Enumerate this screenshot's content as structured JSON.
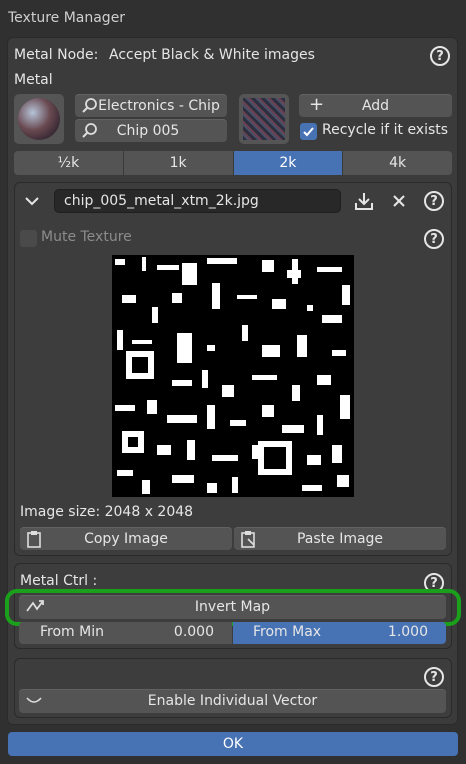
{
  "window": {
    "title": "Texture Manager"
  },
  "header": {
    "node_label": "Metal Node:",
    "node_value": "Accept Black & White images",
    "section": "Metal"
  },
  "material": {
    "search1": "Electronics - Chip",
    "search2": "Chip 005",
    "add_label": "Add",
    "recycle_label": "Recycle if it exists",
    "recycle_checked": true
  },
  "resolution": {
    "options": [
      "½k",
      "1k",
      "2k",
      "4k"
    ],
    "selected": "2k"
  },
  "texture": {
    "filename": "chip_005_metal_xtm_2k.jpg",
    "mute_label": "Mute Texture",
    "image_size": "Image size: 2048 x 2048",
    "copy_label": "Copy Image",
    "paste_label": "Paste Image"
  },
  "ctrl": {
    "title": "Metal Ctrl :",
    "invert_label": "Invert Map",
    "from_min_label": "From Min",
    "from_min_value": "0.000",
    "from_max_label": "From Max",
    "from_max_value": "1.000"
  },
  "vector": {
    "enable_label": "Enable Individual Vector"
  },
  "footer": {
    "ok_label": "OK"
  },
  "colors": {
    "accent": "#4772b3",
    "highlight": "#1aa01a",
    "panel": "#3b3b3b",
    "background": "#303030"
  }
}
